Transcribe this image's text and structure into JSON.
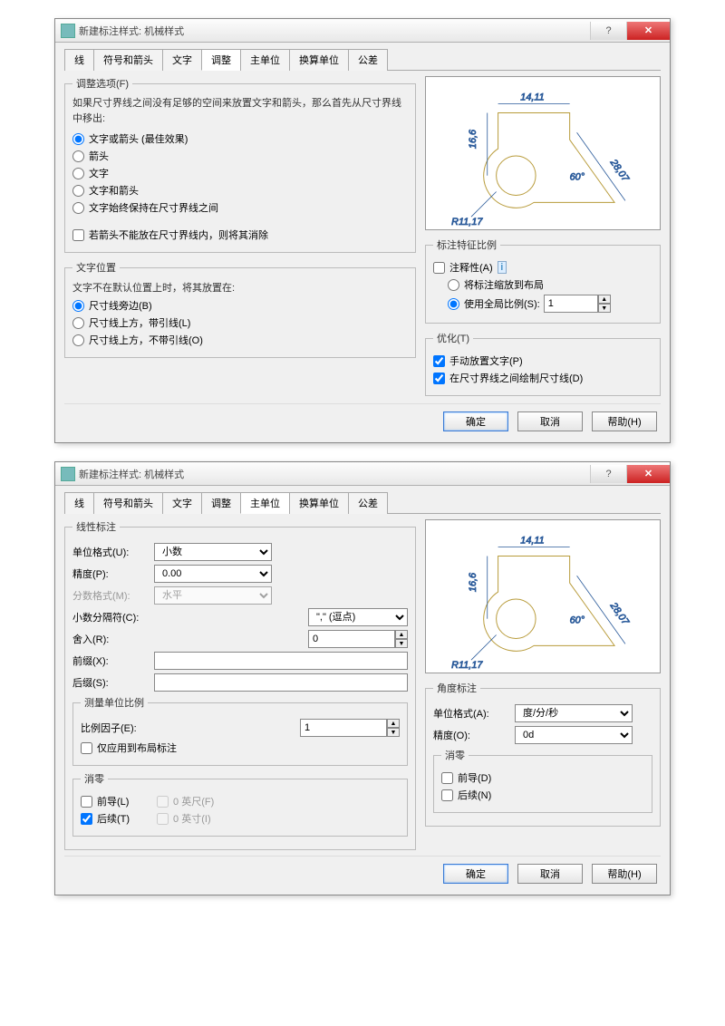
{
  "dialog1": {
    "title": "新建标注样式: 机械样式",
    "tabs": [
      "线",
      "符号和箭头",
      "文字",
      "调整",
      "主单位",
      "换算单位",
      "公差"
    ],
    "activeTab": 3,
    "fitOptions": {
      "legend": "调整选项(F)",
      "intro": "如果尺寸界线之间没有足够的空间来放置文字和箭头，那么首先从尺寸界线中移出:",
      "r1": "文字或箭头 (最佳效果)",
      "r2": "箭头",
      "r3": "文字",
      "r4": "文字和箭头",
      "r5": "文字始终保持在尺寸界线之间",
      "c1": "若箭头不能放在尺寸界线内，则将其消除"
    },
    "textPos": {
      "legend": "文字位置",
      "intro": "文字不在默认位置上时，将其放置在:",
      "r1": "尺寸线旁边(B)",
      "r2": "尺寸线上方，带引线(L)",
      "r3": "尺寸线上方，不带引线(O)"
    },
    "scale": {
      "legend": "标注特征比例",
      "c_anno": "注释性(A)",
      "r_layout": "将标注缩放到布局",
      "r_global": "使用全局比例(S):",
      "global_val": "1"
    },
    "opt": {
      "legend": "优化(T)",
      "c1": "手动放置文字(P)",
      "c2": "在尺寸界线之间绘制尺寸线(D)"
    },
    "preview": {
      "d1": "14,11",
      "d2": "16,6",
      "d3": "28,07",
      "d4": "60°",
      "d5": "R11,17"
    },
    "buttons": {
      "ok": "确定",
      "cancel": "取消",
      "help": "帮助(H)"
    }
  },
  "dialog2": {
    "title": "新建标注样式: 机械样式",
    "tabs": [
      "线",
      "符号和箭头",
      "文字",
      "调整",
      "主单位",
      "换算单位",
      "公差"
    ],
    "activeTab": 4,
    "linear": {
      "legend": "线性标注",
      "unitFormat_l": "单位格式(U):",
      "unitFormat_v": "小数",
      "precision_l": "精度(P):",
      "precision_v": "0.00",
      "fracFormat_l": "分数格式(M):",
      "fracFormat_v": "水平",
      "decSep_l": "小数分隔符(C):",
      "decSep_v": "\",\" (逗点)",
      "round_l": "舍入(R):",
      "round_v": "0",
      "prefix_l": "前缀(X):",
      "prefix_v": "",
      "suffix_l": "后缀(S):",
      "suffix_v": ""
    },
    "measScale": {
      "legend": "测量单位比例",
      "factor_l": "比例因子(E):",
      "factor_v": "1",
      "c_layout": "仅应用到布局标注"
    },
    "zero1": {
      "legend": "消零",
      "c_lead": "前导(L)",
      "c_trail": "后续(T)",
      "c_feet": "0 英尺(F)",
      "c_inch": "0 英寸(I)"
    },
    "angle": {
      "legend": "角度标注",
      "unitFormat_l": "单位格式(A):",
      "unitFormat_v": "度/分/秒",
      "precision_l": "精度(O):",
      "precision_v": "0d"
    },
    "zero2": {
      "legend": "消零",
      "c_lead": "前导(D)",
      "c_trail": "后续(N)"
    },
    "preview": {
      "d1": "14,11",
      "d2": "16,6",
      "d3": "28,07",
      "d4": "60°",
      "d5": "R11,17"
    },
    "buttons": {
      "ok": "确定",
      "cancel": "取消",
      "help": "帮助(H)"
    }
  }
}
